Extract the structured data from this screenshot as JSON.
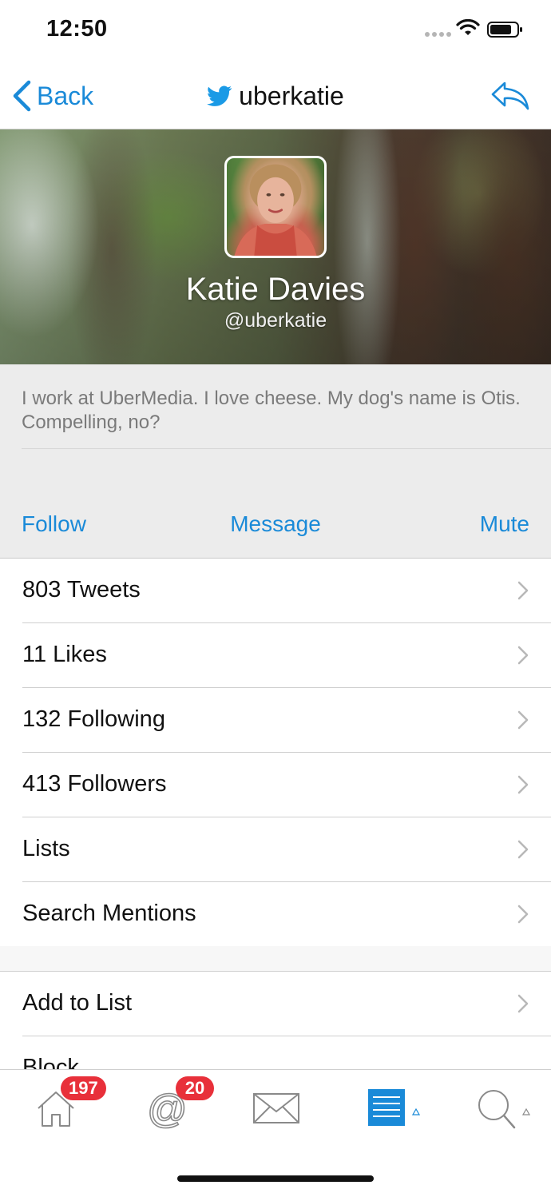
{
  "status_bar": {
    "time": "12:50"
  },
  "nav": {
    "back_label": "Back",
    "title": "uberkatie"
  },
  "profile": {
    "display_name": "Katie Davies",
    "handle": "@uberkatie",
    "bio": "I work at UberMedia. I love cheese. My dog's name is Otis. Compelling, no?"
  },
  "actions": {
    "follow": "Follow",
    "message": "Message",
    "mute": "Mute"
  },
  "stats_list": [
    {
      "label": "803 Tweets"
    },
    {
      "label": "11 Likes"
    },
    {
      "label": "132 Following"
    },
    {
      "label": "413 Followers"
    },
    {
      "label": "Lists"
    },
    {
      "label": "Search Mentions"
    }
  ],
  "manage_list": [
    {
      "label": "Add to List"
    },
    {
      "label": "Block"
    }
  ],
  "tab_bar": {
    "home_badge": "197",
    "mentions_badge": "20"
  },
  "colors": {
    "accent": "#1a8ad8",
    "badge": "#e8303a",
    "bio_bg": "#ececec"
  },
  "icons": [
    "twitter-bird-icon",
    "reply-icon",
    "chevron-right-icon",
    "home-icon",
    "at-icon",
    "mail-icon",
    "list-icon",
    "search-icon"
  ]
}
